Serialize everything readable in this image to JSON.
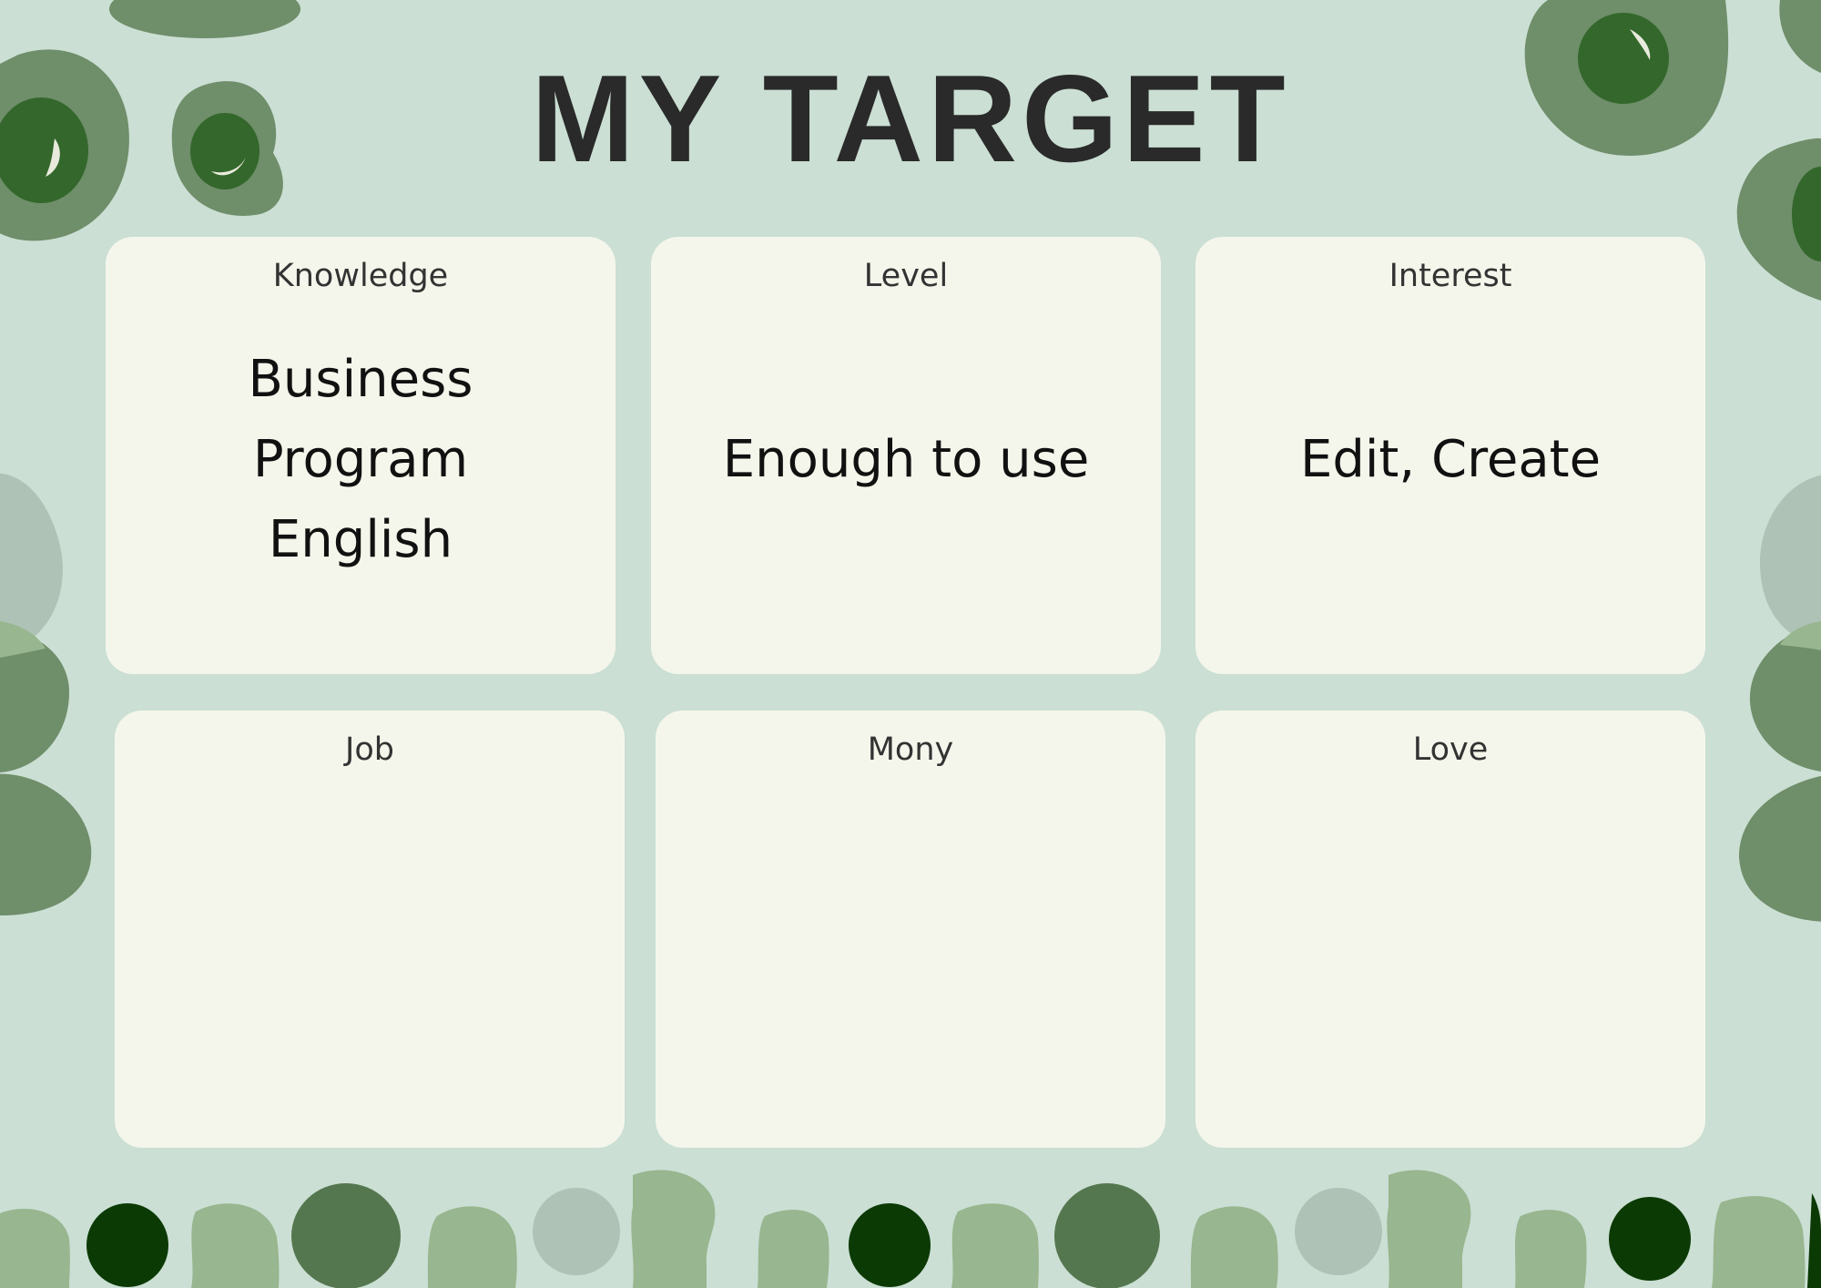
{
  "title": "MY TARGET",
  "colors": {
    "background": "#cbdfd4",
    "card": "#f5f6eb",
    "blob_mid": "#6f8e6a",
    "blob_dark": "#33672b",
    "blob_deep": "#0b3a04",
    "blob_light": "#98b68f",
    "blob_gray": "#aec2b6",
    "blob_dim": "#55774f"
  },
  "cards": [
    {
      "label": "Knowledge",
      "lines": [
        "Business",
        "Program",
        "English"
      ]
    },
    {
      "label": "Level",
      "lines": [
        "Enough to use"
      ]
    },
    {
      "label": "Interest",
      "lines": [
        "Edit, Create"
      ]
    },
    {
      "label": "Job",
      "lines": []
    },
    {
      "label": "Mony",
      "lines": []
    },
    {
      "label": "Love",
      "lines": []
    }
  ]
}
